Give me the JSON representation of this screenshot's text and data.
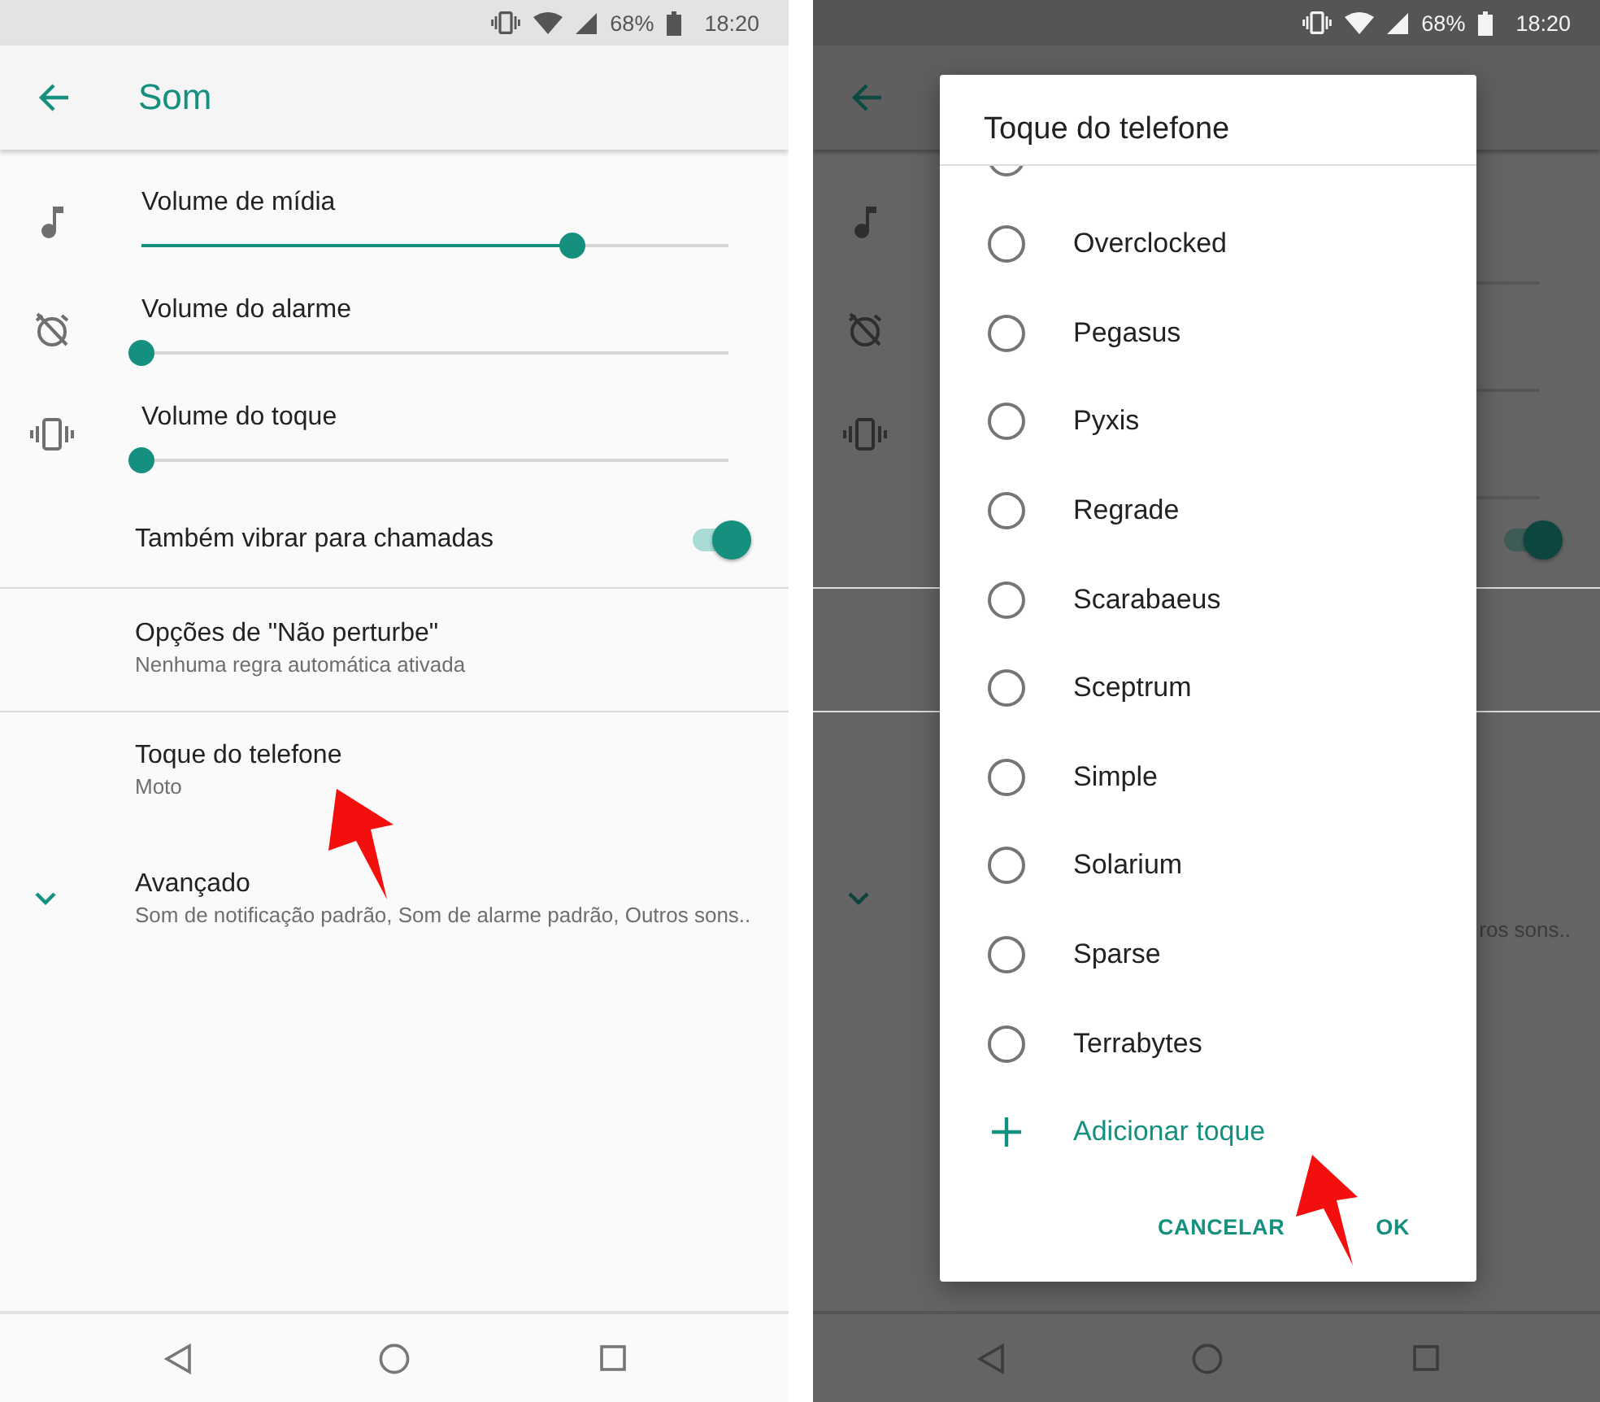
{
  "left": {
    "status_bar": {
      "battery": "68%",
      "time": "18:20"
    },
    "title": "Som",
    "volumes": [
      {
        "label": "Volume de mídia",
        "level": 0.735
      },
      {
        "label": "Volume do alarme",
        "level": 0
      },
      {
        "label": "Volume do toque",
        "level": 0
      }
    ],
    "vibrate": {
      "label": "Também vibrar para chamadas",
      "on": true
    },
    "items": [
      {
        "title": "Opções de \"Não perturbe\"",
        "summary": "Nenhuma regra automática ativada"
      },
      {
        "title": "Toque do telefone",
        "summary": "Moto"
      }
    ],
    "advanced": {
      "title": "Avançado",
      "summary": "Som de notificação padrão, Som de alarme padrão, Outros sons..",
      "expanded": false
    }
  },
  "right": {
    "status_bar": {
      "battery": "68%",
      "time": "18:20"
    },
    "behind": {
      "toggle_on": true,
      "summary_fragment": "ros sons.."
    },
    "dialog": {
      "title": "Toque do telefone",
      "partial_option": {
        "selected": false
      },
      "options": [
        {
          "label": "Overclocked",
          "selected": false
        },
        {
          "label": "Pegasus",
          "selected": false
        },
        {
          "label": "Pyxis",
          "selected": false
        },
        {
          "label": "Regrade",
          "selected": false
        },
        {
          "label": "Scarabaeus",
          "selected": false
        },
        {
          "label": "Sceptrum",
          "selected": false
        },
        {
          "label": "Simple",
          "selected": false
        },
        {
          "label": "Solarium",
          "selected": false
        },
        {
          "label": "Sparse",
          "selected": false
        },
        {
          "label": "Terrabytes",
          "selected": false
        }
      ],
      "add_label": "Adicionar toque",
      "buttons": [
        "CANCELAR",
        "OK"
      ]
    }
  }
}
